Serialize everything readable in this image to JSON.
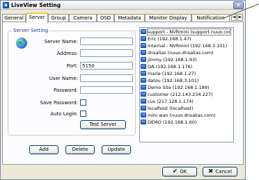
{
  "window": {
    "title": "LiveView Setting",
    "close_label": "✕"
  },
  "tabs": [
    {
      "label": "General"
    },
    {
      "label": "Server"
    },
    {
      "label": "Group"
    },
    {
      "label": "Camera"
    },
    {
      "label": "OSD"
    },
    {
      "label": "Metadata"
    },
    {
      "label": "Monitor Display"
    },
    {
      "label": "Notification"
    }
  ],
  "tab_scroll": {
    "left": "◄",
    "right": "►"
  },
  "server_setting": {
    "group_title": "Server Setting",
    "server_name_label": "Server Name:",
    "server_name_value": "",
    "address_label": "Address:",
    "address_value": "",
    "port_label": "Port:",
    "port_value": "5150",
    "user_name_label": "User Name:",
    "user_name_value": "",
    "password_label": "Password:",
    "password_value": "",
    "save_password_label": "Save Password:",
    "save_password_checked": false,
    "auto_login_label": "Auto Login:",
    "auto_login_checked": false,
    "test_server_label": "Test Server"
  },
  "actions": {
    "add_label": "Add",
    "delete_label": "Delete",
    "update_label": "Update"
  },
  "server_list": [
    {
      "label": "support - NVRmini (support.nuuo.cor",
      "selected": true
    },
    {
      "label": "Eric (192.168.1.47)"
    },
    {
      "label": "Internal - NVRmini (192.168.3.101)"
    },
    {
      "label": "dnsalias (nuuo.dnsalias.com)"
    },
    {
      "label": "jimmy (192.168.1.93)"
    },
    {
      "label": "QA (192.168.1.176)"
    },
    {
      "label": "marie (192.168.1.27)"
    },
    {
      "label": "datou (192.168.3.101)"
    },
    {
      "label": "Demo Site (192.168.1.189)"
    },
    {
      "label": "customer (212.143.234.227)"
    },
    {
      "label": "cus (217.128.1.174)"
    },
    {
      "label": "localhost (localhost)"
    },
    {
      "label": "mini wan (nuuo.dnsalias.com)"
    },
    {
      "label": "DEMO (192.168.1.60)"
    }
  ],
  "dialog": {
    "ok_label": "OK",
    "ok_mark": "✔",
    "cancel_label": "Cancel",
    "cancel_mark": "✖"
  }
}
